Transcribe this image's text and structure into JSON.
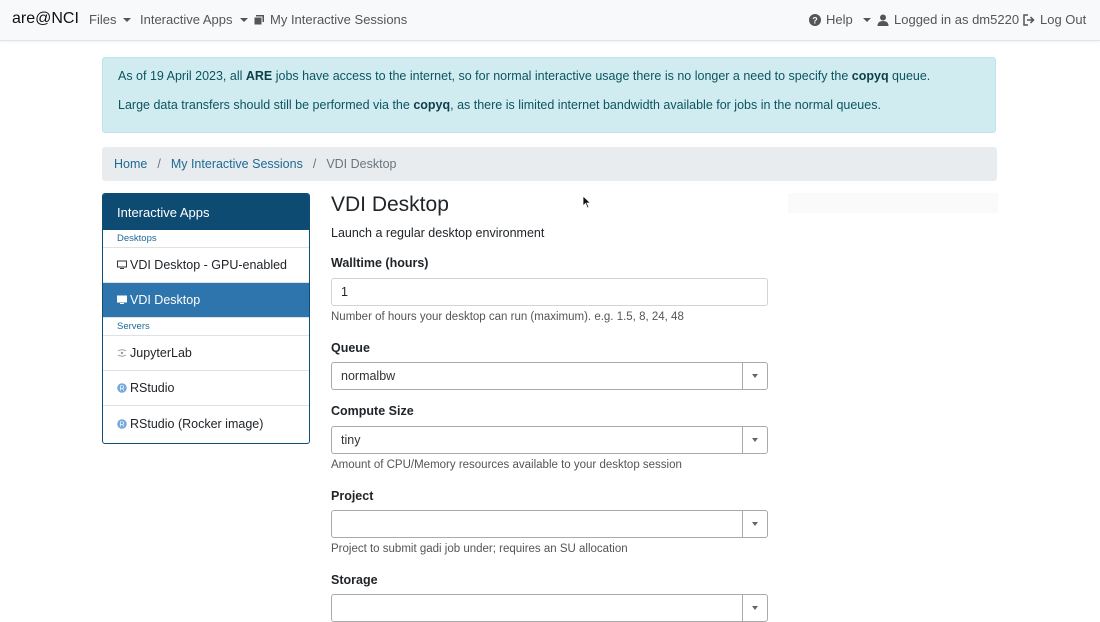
{
  "navbar": {
    "brand": "are@NCI",
    "files": "Files",
    "interactive_apps": "Interactive Apps",
    "my_sessions": "My Interactive Sessions",
    "help": "Help",
    "logged_in": "Logged in as dm5220",
    "logout": "Log Out"
  },
  "alert": {
    "line1_pre": "As of 19 April 2023, all ",
    "line1_b1": "ARE",
    "line1_mid": " jobs have access to the internet, so for normal interactive usage there is no longer a need to specify the ",
    "line1_b2": "copyq",
    "line1_post": " queue.",
    "line2_pre": "Large data transfers should still be performed via the ",
    "line2_b1": "copyq",
    "line2_post": ", as there is limited internet bandwidth available for jobs in the normal queues."
  },
  "breadcrumb": {
    "home": "Home",
    "sessions": "My Interactive Sessions",
    "current": "VDI Desktop",
    "sep": "/"
  },
  "sidebar": {
    "header": "Interactive Apps",
    "cat_desktops": "Desktops",
    "cat_servers": "Servers",
    "items": [
      {
        "label": "VDI Desktop - GPU-enabled",
        "icon": "monitor-icon"
      },
      {
        "label": "VDI Desktop",
        "icon": "monitor-icon"
      },
      {
        "label": "JupyterLab",
        "icon": "jupyter-icon"
      },
      {
        "label": "RStudio",
        "icon": "rstudio-icon"
      },
      {
        "label": "RStudio (Rocker image)",
        "icon": "rstudio-icon"
      }
    ]
  },
  "form": {
    "title": "VDI Desktop",
    "subtitle": "Launch a regular desktop environment",
    "walltime_label": "Walltime (hours)",
    "walltime_value": "1",
    "walltime_help": "Number of hours your desktop can run (maximum). e.g. 1.5, 8, 24, 48",
    "queue_label": "Queue",
    "queue_value": "normalbw",
    "compute_label": "Compute Size",
    "compute_value": "tiny",
    "compute_help": "Amount of CPU/Memory resources available to your desktop session",
    "project_label": "Project",
    "project_value": "",
    "project_help": "Project to submit gadi job under; requires an SU allocation",
    "storage_label": "Storage"
  },
  "colors": {
    "navbar_bg": "#f8f9fa",
    "alert_bg": "#d1ecf1",
    "sidebar_header": "#0e4b73",
    "sidebar_active": "#2f75ad",
    "link": "#1d6a95"
  }
}
